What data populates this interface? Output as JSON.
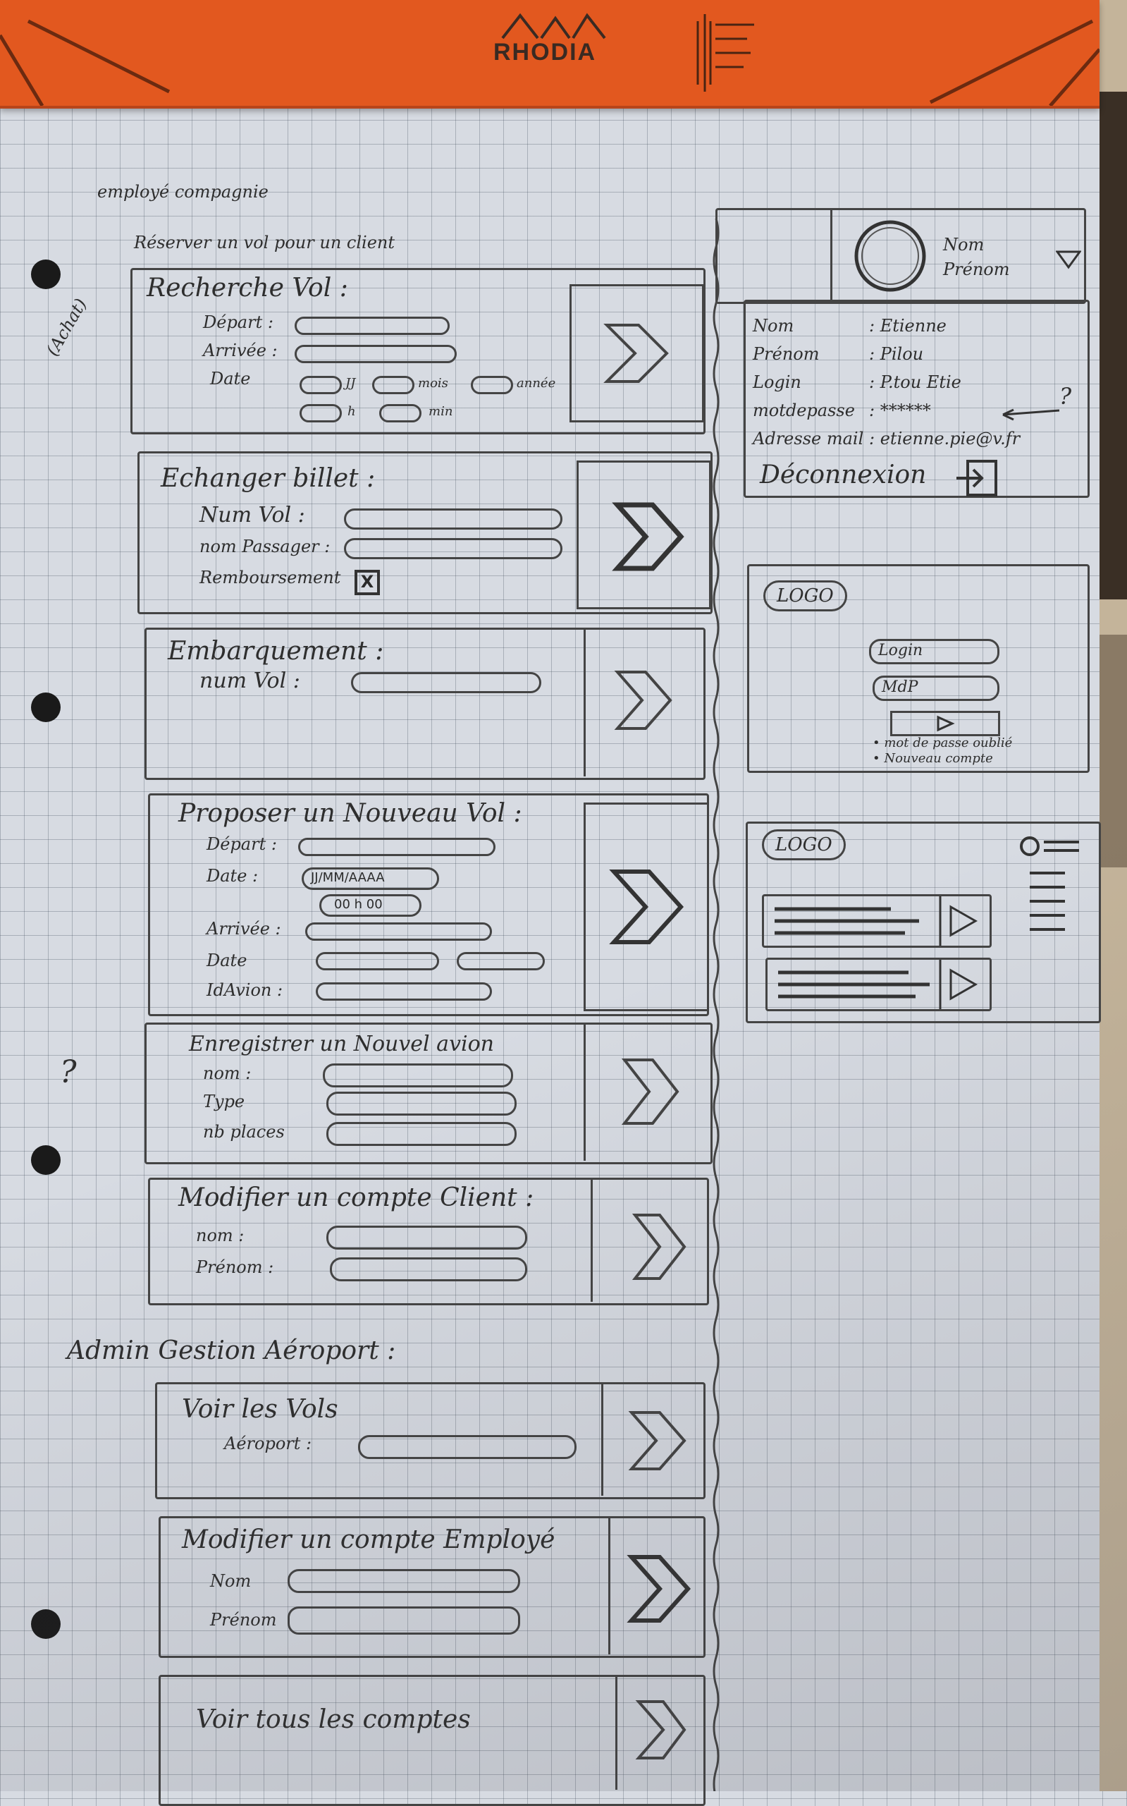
{
  "pad": {
    "brand": "RHODIA"
  },
  "page_heading": "employé compagnie",
  "side_note": "(Achat)",
  "section_subtitle": "Réserver un vol pour un client",
  "sections": {
    "recherche": {
      "title": "Recherche Vol :",
      "depart": "Départ :",
      "arrivee": "Arrivée :",
      "date": "Date",
      "jj": "JJ",
      "mois": "mois",
      "annee": "année",
      "h": "h",
      "min": "min"
    },
    "echange": {
      "title": "Echanger billet :",
      "num_vol": "Num Vol :",
      "nom_passager": "nom Passager :",
      "remboursement": "Remboursement",
      "check_mark": "X"
    },
    "embarquement": {
      "title": "Embarquement :",
      "num_vol": "num Vol :"
    },
    "proposer": {
      "title": "Proposer un Nouveau Vol :",
      "depart": "Départ :",
      "date": "Date :",
      "date_placeholder": "JJ/MM/AAAA",
      "time_placeholder": "00 h 00",
      "arrivee": "Arrivée :",
      "date2": "Date",
      "idavion": "IdAvion :"
    },
    "enregistrer": {
      "title": "Enregistrer un Nouvel avion",
      "nom": "nom :",
      "type": "Type",
      "nb_places": "nb places"
    },
    "modifier_client": {
      "title": "Modifier un compte Client :",
      "nom": "nom :",
      "prenom": "Prénom :"
    },
    "question_mark": "?"
  },
  "admin": {
    "heading": "Admin Gestion Aéroport :",
    "voir_vols": {
      "title": "Voir les Vols",
      "aeroport": "Aéroport :"
    },
    "modifier_employe": {
      "title": "Modifier un compte Employé",
      "nom": "Nom",
      "prenom": "Prénom"
    },
    "voir_comptes": {
      "title": "Voir tous les comptes"
    }
  },
  "profile": {
    "nom_label": "Nom",
    "prenom_label": "Prénom",
    "fields": [
      {
        "label": "Nom",
        "value": ": Etienne"
      },
      {
        "label": "Prénom",
        "value": ": Pilou"
      },
      {
        "label": "Login",
        "value": ": P.tou Etie"
      },
      {
        "label": "motdepasse",
        "value": ": ******"
      },
      {
        "label": "Adresse mail",
        "value": ": etienne.pie@v.fr"
      }
    ],
    "help_mark": "?",
    "logout": "Déconnexion"
  },
  "login_screen": {
    "logo": "LOGO",
    "login": "Login",
    "mdp": "MdP",
    "forgot": "• mot de passe oublié",
    "new_account": "• Nouveau compte"
  },
  "home_screen": {
    "logo": "LOGO"
  }
}
